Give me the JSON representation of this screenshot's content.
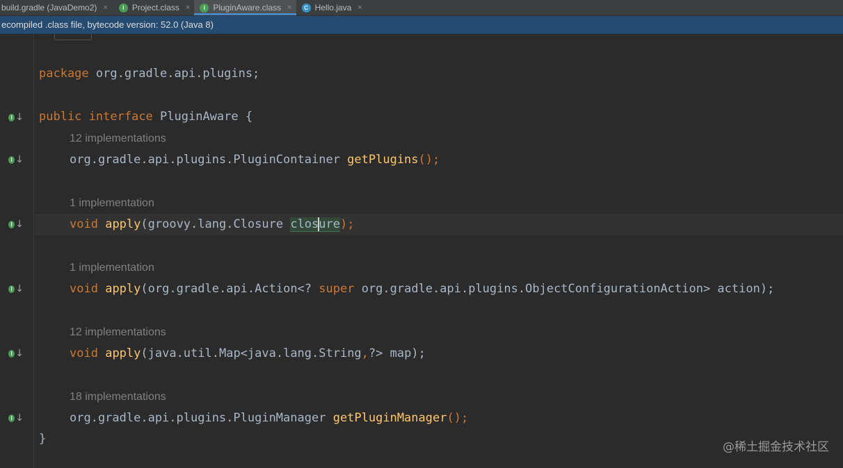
{
  "tabs": [
    {
      "label": "build.gradle (JavaDemo2)",
      "icon": "none",
      "active": false
    },
    {
      "label": "Project.class",
      "icon": "interface-icon",
      "active": false
    },
    {
      "label": "PluginAware.class",
      "icon": "interface-icon",
      "active": true
    },
    {
      "label": "Hello.java",
      "icon": "class-icon",
      "active": false
    }
  ],
  "close_glyph": "×",
  "banner": {
    "text": "ecompiled .class file, bytecode version: 52.0 (Java 8)"
  },
  "fold_marker": "/**/",
  "code": {
    "package_kw": "package",
    "package_name": " org.gradle.api.plugins;",
    "public_kw": "public",
    "interface_kw": "interface",
    "interface_name": " PluginAware {",
    "hint1": "12 implementations",
    "m1_type": "org.gradle.api.plugins.PluginContainer ",
    "m1_name": "getPlugins",
    "m1_tail": "();",
    "hint2": "1 implementation",
    "void_kw": "void",
    "apply_name": "apply",
    "m2_params": "(groovy.lang.Closure ",
    "m2_param_name_a": "clos",
    "m2_param_name_b": "ure",
    "m2_tail": ");",
    "hint3": "1 implementation",
    "m3_params_a": "(org.gradle.api.Action<? ",
    "super_kw": "super",
    "m3_params_b": " org.gradle.api.plugins.ObjectConfigurationAction> action);",
    "hint4": "12 implementations",
    "m4_params_a": "(java.util.Map<java.lang.String",
    "m4_comma": ",",
    "m4_params_b": "?> map);",
    "hint5": "18 implementations",
    "m5_type": "org.gradle.api.plugins.PluginManager ",
    "m5_name": "getPluginManager",
    "m5_tail": "();",
    "close_brace": "}"
  },
  "gutter_icon_letter": "I",
  "gutter_arrow": "↓",
  "watermark": "@稀土掘金技术社区",
  "colors": {
    "keyword": "#cc7832",
    "method": "#ffc66d",
    "text": "#a9b7c6",
    "hint": "#808080",
    "banner": "#254b70",
    "implemented_icon": "#499c54"
  }
}
